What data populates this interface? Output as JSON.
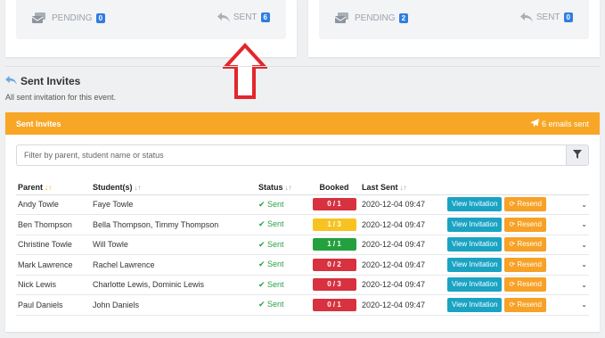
{
  "stats": {
    "left": {
      "pending_label": "PENDING",
      "pending_count": "0",
      "sent_label": "SENT",
      "sent_count": "6"
    },
    "right": {
      "pending_label": "PENDING",
      "pending_count": "2",
      "sent_label": "SENT",
      "sent_count": "0"
    }
  },
  "section": {
    "title": "Sent Invites",
    "description": "All sent invitation for this event."
  },
  "card": {
    "title": "Sent Invites",
    "emails_sent": "6 emails sent"
  },
  "filter": {
    "placeholder": "Filter by parent, student name or status"
  },
  "table": {
    "headers": {
      "parent": "Parent",
      "students": "Student(s)",
      "status": "Status",
      "booked": "Booked",
      "last_sent": "Last Sent"
    },
    "view_label": "View Invitation",
    "resend_label": "Resend",
    "rows": [
      {
        "parent": "Andy Towle",
        "students": "Faye Towle",
        "status": "Sent",
        "booked": "0 / 1",
        "booked_color": "red",
        "last_sent": "2020-12-04 09:47"
      },
      {
        "parent": "Ben Thompson",
        "students": "Bella Thompson, Timmy Thompson",
        "status": "Sent",
        "booked": "1 / 3",
        "booked_color": "yellow",
        "last_sent": "2020-12-04 09:47"
      },
      {
        "parent": "Christine Towle",
        "students": "Will Towle",
        "status": "Sent",
        "booked": "1 / 1",
        "booked_color": "green",
        "last_sent": "2020-12-04 09:47"
      },
      {
        "parent": "Mark Lawrence",
        "students": "Rachel Lawrence",
        "status": "Sent",
        "booked": "0 / 2",
        "booked_color": "red",
        "last_sent": "2020-12-04 09:47"
      },
      {
        "parent": "Nick Lewis",
        "students": "Charlotte Lewis, Dominic Lewis",
        "status": "Sent",
        "booked": "0 / 3",
        "booked_color": "red",
        "last_sent": "2020-12-04 09:47"
      },
      {
        "parent": "Paul Daniels",
        "students": "John Daniels",
        "status": "Sent",
        "booked": "0 / 1",
        "booked_color": "red",
        "last_sent": "2020-12-04 09:47"
      }
    ]
  },
  "colors": {
    "accent_orange": "#f8a626",
    "sent_green": "#27a243",
    "badge_blue": "#2f7de1",
    "arrow_red": "#e3262a"
  }
}
